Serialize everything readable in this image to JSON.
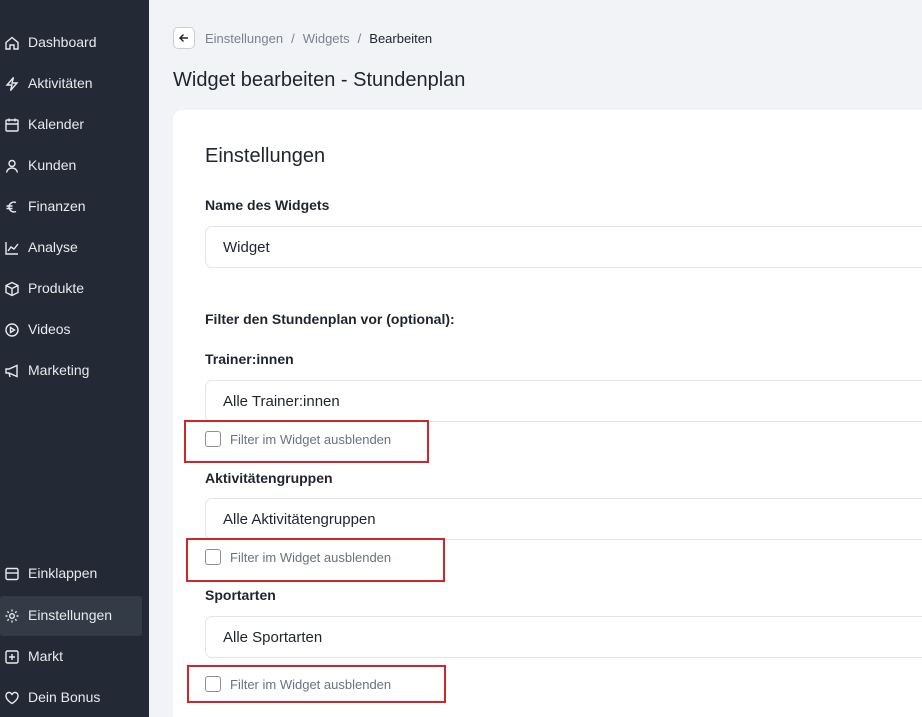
{
  "sidebar": {
    "items": [
      {
        "label": "Dashboard",
        "icon": "home-icon"
      },
      {
        "label": "Aktivitäten",
        "icon": "lightning-icon"
      },
      {
        "label": "Kalender",
        "icon": "calendar-icon"
      },
      {
        "label": "Kunden",
        "icon": "user-icon"
      },
      {
        "label": "Finanzen",
        "icon": "euro-icon"
      },
      {
        "label": "Analyse",
        "icon": "chart-line-icon"
      },
      {
        "label": "Produkte",
        "icon": "box-icon"
      },
      {
        "label": "Videos",
        "icon": "play-circle-icon"
      },
      {
        "label": "Marketing",
        "icon": "megaphone-icon"
      }
    ],
    "bottom_items": [
      {
        "label": "Einklappen",
        "icon": "collapse-icon"
      },
      {
        "label": "Einstellungen",
        "icon": "gear-icon",
        "active": true
      },
      {
        "label": "Markt",
        "icon": "plus-square-icon"
      },
      {
        "label": "Dein Bonus",
        "icon": "heart-icon"
      }
    ]
  },
  "breadcrumb": {
    "items": [
      "Einstellungen",
      "Widgets",
      "Bearbeiten"
    ],
    "separator": "/"
  },
  "page_title": "Widget bearbeiten - Stundenplan",
  "card": {
    "section_title": "Einstellungen",
    "name_label": "Name des Widgets",
    "name_value": "Widget",
    "filter_heading": "Filter den Stundenplan vor (optional):",
    "filters": [
      {
        "label": "Trainer:innen",
        "value": "Alle Trainer:innen",
        "hide_label": "Filter im Widget ausblenden",
        "checked": false
      },
      {
        "label": "Aktivitätengruppen",
        "value": "Alle Aktivitätengruppen",
        "hide_label": "Filter im Widget ausblenden",
        "checked": false
      },
      {
        "label": "Sportarten",
        "value": "Alle Sportarten",
        "hide_label": "Filter im Widget ausblenden",
        "checked": false
      }
    ]
  },
  "colors": {
    "sidebar_bg": "#232a35",
    "sidebar_active": "#333b47",
    "page_bg": "#f1f3f6",
    "highlight": "#d0262a"
  }
}
